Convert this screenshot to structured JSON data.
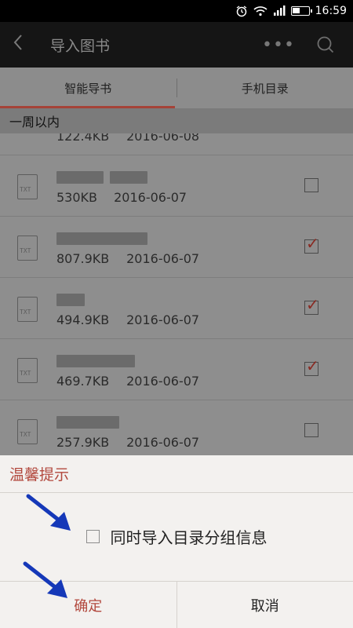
{
  "status_bar": {
    "time": "16:59"
  },
  "app_bar": {
    "back_icon": "back-chevron-icon",
    "title": "导入图书",
    "more_label": "•••",
    "search_icon": "search-icon"
  },
  "tabs": [
    {
      "label": "智能导书",
      "active": true
    },
    {
      "label": "手机目录",
      "active": false
    }
  ],
  "section": {
    "label": "一周以内"
  },
  "files": [
    {
      "type_label": "TXT",
      "size": "122.4KB",
      "date": "2016-06-08",
      "checked": false,
      "partial": true
    },
    {
      "type_label": "TXT",
      "size": "530KB",
      "date": "2016-06-07",
      "checked": false
    },
    {
      "type_label": "TXT",
      "size": "807.9KB",
      "date": "2016-06-07",
      "checked": true
    },
    {
      "type_label": "TXT",
      "size": "494.9KB",
      "date": "2016-06-07",
      "checked": true
    },
    {
      "type_label": "TXT",
      "size": "469.7KB",
      "date": "2016-06-07",
      "checked": true
    },
    {
      "type_label": "TXT",
      "size": "257.9KB",
      "date": "2016-06-07",
      "checked": false
    }
  ],
  "dialog": {
    "title": "温馨提示",
    "option_label": "同时导入目录分组信息",
    "option_checked": false,
    "confirm_label": "确定",
    "cancel_label": "取消"
  },
  "colors": {
    "accent": "#b2483d",
    "dim_overlay": "#8e8e8e",
    "app_bar_bg": "#151515"
  }
}
